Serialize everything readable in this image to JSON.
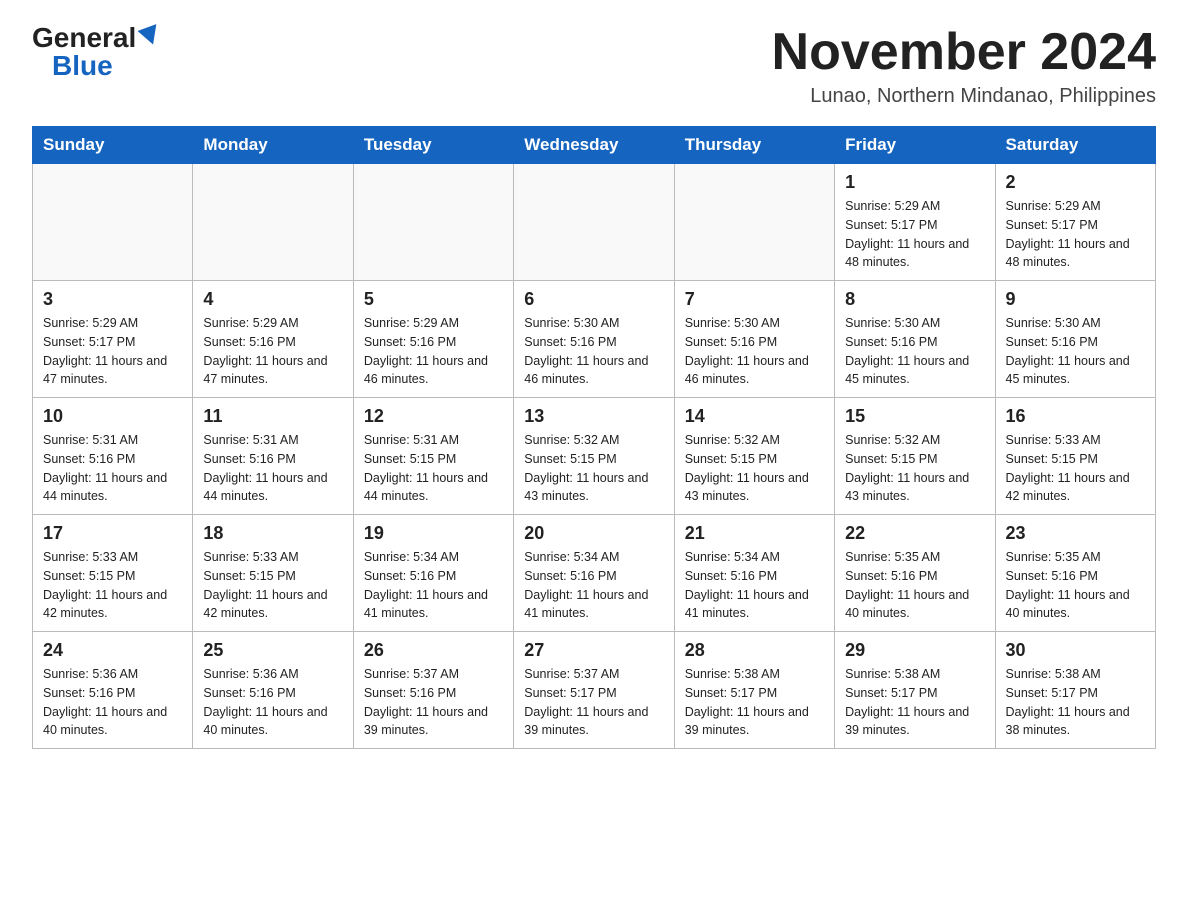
{
  "header": {
    "logo_general": "General",
    "logo_blue": "Blue",
    "month_title": "November 2024",
    "location": "Lunao, Northern Mindanao, Philippines"
  },
  "weekdays": [
    "Sunday",
    "Monday",
    "Tuesday",
    "Wednesday",
    "Thursday",
    "Friday",
    "Saturday"
  ],
  "weeks": [
    [
      {
        "day": "",
        "info": ""
      },
      {
        "day": "",
        "info": ""
      },
      {
        "day": "",
        "info": ""
      },
      {
        "day": "",
        "info": ""
      },
      {
        "day": "",
        "info": ""
      },
      {
        "day": "1",
        "info": "Sunrise: 5:29 AM\nSunset: 5:17 PM\nDaylight: 11 hours and 48 minutes."
      },
      {
        "day": "2",
        "info": "Sunrise: 5:29 AM\nSunset: 5:17 PM\nDaylight: 11 hours and 48 minutes."
      }
    ],
    [
      {
        "day": "3",
        "info": "Sunrise: 5:29 AM\nSunset: 5:17 PM\nDaylight: 11 hours and 47 minutes."
      },
      {
        "day": "4",
        "info": "Sunrise: 5:29 AM\nSunset: 5:16 PM\nDaylight: 11 hours and 47 minutes."
      },
      {
        "day": "5",
        "info": "Sunrise: 5:29 AM\nSunset: 5:16 PM\nDaylight: 11 hours and 46 minutes."
      },
      {
        "day": "6",
        "info": "Sunrise: 5:30 AM\nSunset: 5:16 PM\nDaylight: 11 hours and 46 minutes."
      },
      {
        "day": "7",
        "info": "Sunrise: 5:30 AM\nSunset: 5:16 PM\nDaylight: 11 hours and 46 minutes."
      },
      {
        "day": "8",
        "info": "Sunrise: 5:30 AM\nSunset: 5:16 PM\nDaylight: 11 hours and 45 minutes."
      },
      {
        "day": "9",
        "info": "Sunrise: 5:30 AM\nSunset: 5:16 PM\nDaylight: 11 hours and 45 minutes."
      }
    ],
    [
      {
        "day": "10",
        "info": "Sunrise: 5:31 AM\nSunset: 5:16 PM\nDaylight: 11 hours and 44 minutes."
      },
      {
        "day": "11",
        "info": "Sunrise: 5:31 AM\nSunset: 5:16 PM\nDaylight: 11 hours and 44 minutes."
      },
      {
        "day": "12",
        "info": "Sunrise: 5:31 AM\nSunset: 5:15 PM\nDaylight: 11 hours and 44 minutes."
      },
      {
        "day": "13",
        "info": "Sunrise: 5:32 AM\nSunset: 5:15 PM\nDaylight: 11 hours and 43 minutes."
      },
      {
        "day": "14",
        "info": "Sunrise: 5:32 AM\nSunset: 5:15 PM\nDaylight: 11 hours and 43 minutes."
      },
      {
        "day": "15",
        "info": "Sunrise: 5:32 AM\nSunset: 5:15 PM\nDaylight: 11 hours and 43 minutes."
      },
      {
        "day": "16",
        "info": "Sunrise: 5:33 AM\nSunset: 5:15 PM\nDaylight: 11 hours and 42 minutes."
      }
    ],
    [
      {
        "day": "17",
        "info": "Sunrise: 5:33 AM\nSunset: 5:15 PM\nDaylight: 11 hours and 42 minutes."
      },
      {
        "day": "18",
        "info": "Sunrise: 5:33 AM\nSunset: 5:15 PM\nDaylight: 11 hours and 42 minutes."
      },
      {
        "day": "19",
        "info": "Sunrise: 5:34 AM\nSunset: 5:16 PM\nDaylight: 11 hours and 41 minutes."
      },
      {
        "day": "20",
        "info": "Sunrise: 5:34 AM\nSunset: 5:16 PM\nDaylight: 11 hours and 41 minutes."
      },
      {
        "day": "21",
        "info": "Sunrise: 5:34 AM\nSunset: 5:16 PM\nDaylight: 11 hours and 41 minutes."
      },
      {
        "day": "22",
        "info": "Sunrise: 5:35 AM\nSunset: 5:16 PM\nDaylight: 11 hours and 40 minutes."
      },
      {
        "day": "23",
        "info": "Sunrise: 5:35 AM\nSunset: 5:16 PM\nDaylight: 11 hours and 40 minutes."
      }
    ],
    [
      {
        "day": "24",
        "info": "Sunrise: 5:36 AM\nSunset: 5:16 PM\nDaylight: 11 hours and 40 minutes."
      },
      {
        "day": "25",
        "info": "Sunrise: 5:36 AM\nSunset: 5:16 PM\nDaylight: 11 hours and 40 minutes."
      },
      {
        "day": "26",
        "info": "Sunrise: 5:37 AM\nSunset: 5:16 PM\nDaylight: 11 hours and 39 minutes."
      },
      {
        "day": "27",
        "info": "Sunrise: 5:37 AM\nSunset: 5:17 PM\nDaylight: 11 hours and 39 minutes."
      },
      {
        "day": "28",
        "info": "Sunrise: 5:38 AM\nSunset: 5:17 PM\nDaylight: 11 hours and 39 minutes."
      },
      {
        "day": "29",
        "info": "Sunrise: 5:38 AM\nSunset: 5:17 PM\nDaylight: 11 hours and 39 minutes."
      },
      {
        "day": "30",
        "info": "Sunrise: 5:38 AM\nSunset: 5:17 PM\nDaylight: 11 hours and 38 minutes."
      }
    ]
  ]
}
